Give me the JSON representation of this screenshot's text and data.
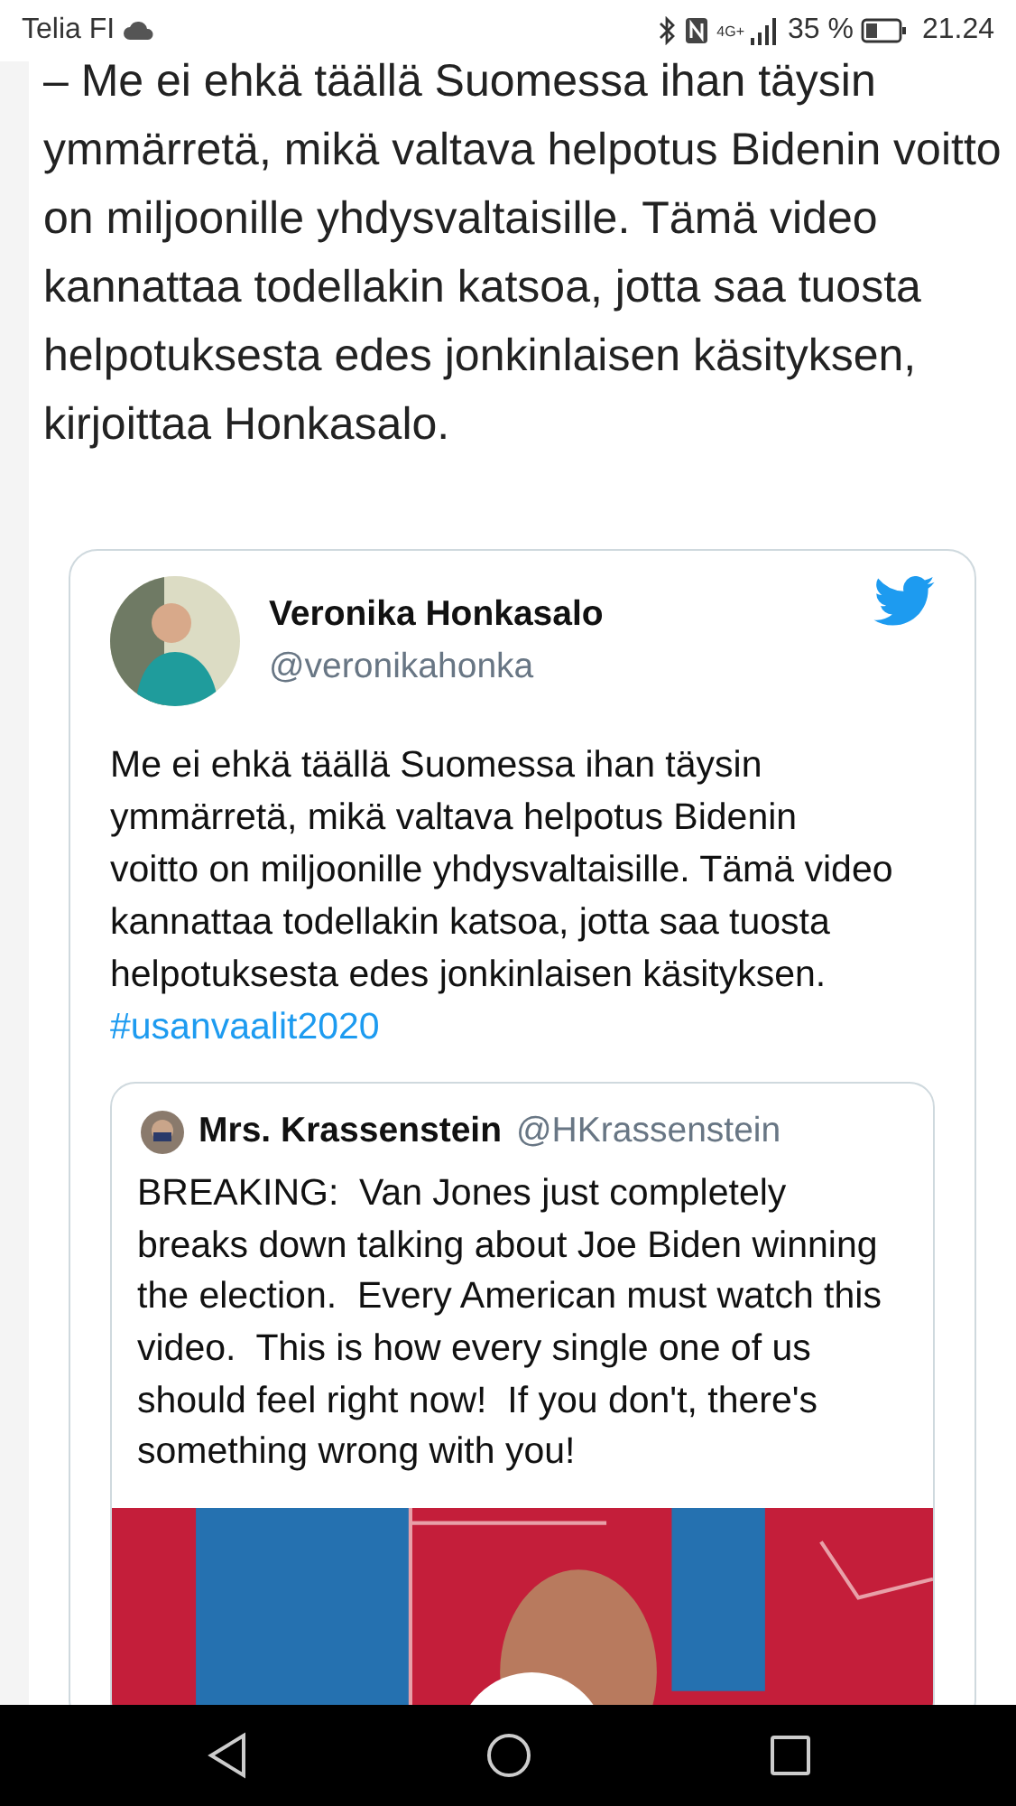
{
  "status_bar": {
    "carrier": "Telia FI",
    "network": "4G+",
    "battery_text": "35 %",
    "time": "21.24"
  },
  "article": {
    "paragraph": "– Me ei ehkä täällä Suomessa ihan täysin ymmärretä, mikä valtava helpotus Bidenin voitto on miljoonille yhdysvaltaisille. Tämä video kannattaa todellakin katsoa, jotta saa tuosta helpotuksesta edes jonkinlaisen käsityksen, kirjoittaa Honkasalo."
  },
  "tweet": {
    "name": "Veronika Honkasalo",
    "handle": "@veronikahonka",
    "text": "Me ei ehkä täällä Suomessa ihan täysin ymmärretä, mikä valtava helpotus Bidenin voitto on miljoonille yhdysvaltaisille. Tämä video kannattaa todellakin katsoa, jotta saa tuosta helpotuksesta edes jonkinlaisen käsityksen.",
    "hashtag": "#usanvaalit2020",
    "quoted": {
      "name": "Mrs. Krassenstein",
      "handle": "@HKrassenstein",
      "text": "BREAKING:  Van Jones just completely breaks down talking about Joe Biden winning the election.  Every American must watch this video.  This is how every single one of us should feel right now!  If you don't, there's something wrong with you!"
    }
  }
}
